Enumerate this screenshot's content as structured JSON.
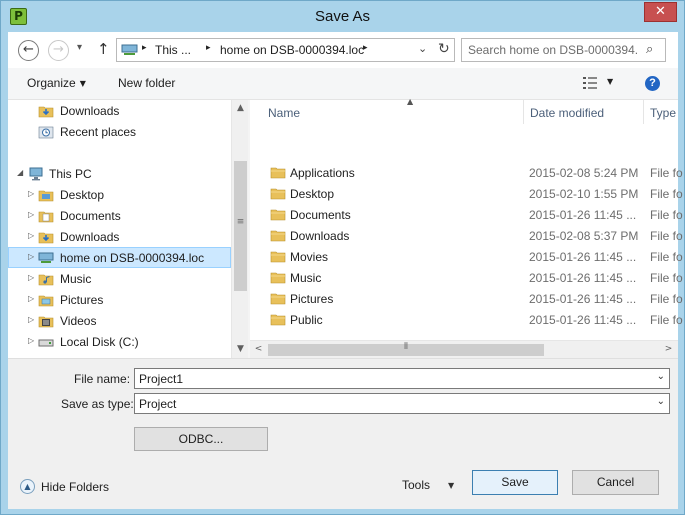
{
  "window": {
    "title": "Save As",
    "app_icon_letter": "P",
    "close_glyph": "✕"
  },
  "address_bar": {
    "back_glyph": "←",
    "forward_glyph": "→",
    "history_glyph": "▾",
    "up_glyph": "↑",
    "crumbs": [
      "This ...",
      "home on DSB-0000394.loc"
    ],
    "separator_glyph": "▸",
    "dropdown_glyph": "⌄",
    "refresh_glyph": "↻",
    "search_placeholder": "Search home on DSB-0000394...",
    "search_glyph": "⌕"
  },
  "toolbar": {
    "organize_label": "Organize",
    "new_folder_label": "New folder",
    "caret_glyph": "▼",
    "help_glyph": "?"
  },
  "nav_pane": {
    "items": [
      {
        "label": "Downloads",
        "icon": "downloads-icon",
        "expander": ""
      },
      {
        "label": "Recent places",
        "icon": "recent-places-icon",
        "expander": ""
      },
      {
        "label": "This PC",
        "icon": "this-pc-icon",
        "expander": "◢"
      },
      {
        "label": "Desktop",
        "icon": "folder-icon",
        "expander": "▷"
      },
      {
        "label": "Documents",
        "icon": "folder-icon",
        "expander": "▷"
      },
      {
        "label": "Downloads",
        "icon": "downloads-icon",
        "expander": "▷"
      },
      {
        "label": "home on DSB-0000394.loc",
        "icon": "network-drive-icon",
        "expander": "▷",
        "selected": true
      },
      {
        "label": "Music",
        "icon": "folder-icon",
        "expander": "▷"
      },
      {
        "label": "Pictures",
        "icon": "folder-icon",
        "expander": "▷"
      },
      {
        "label": "Videos",
        "icon": "folder-icon",
        "expander": "▷"
      },
      {
        "label": "Local Disk (C:)",
        "icon": "local-disk-icon",
        "expander": "▷"
      }
    ],
    "scroll_up_glyph": "▲",
    "scroll_down_glyph": "▼",
    "grip_glyph": "≡"
  },
  "file_list": {
    "columns": [
      "Name",
      "Date modified",
      "Type"
    ],
    "sort_glyph": "▲",
    "rows": [
      {
        "name": "Applications",
        "date": "2015-02-08 5:24 PM",
        "type": "File fo"
      },
      {
        "name": "Desktop",
        "date": "2015-02-10 1:55 PM",
        "type": "File fo"
      },
      {
        "name": "Documents",
        "date": "2015-01-26 11:45 ...",
        "type": "File fo"
      },
      {
        "name": "Downloads",
        "date": "2015-02-08 5:37 PM",
        "type": "File fo"
      },
      {
        "name": "Movies",
        "date": "2015-01-26 11:45 ...",
        "type": "File fo"
      },
      {
        "name": "Music",
        "date": "2015-01-26 11:45 ...",
        "type": "File fo"
      },
      {
        "name": "Pictures",
        "date": "2015-01-26 11:45 ...",
        "type": "File fo"
      },
      {
        "name": "Public",
        "date": "2015-01-26 11:45 ...",
        "type": "File fo"
      }
    ],
    "scroll_left_glyph": "<",
    "scroll_right_glyph": ">",
    "grip_glyph": "⦀"
  },
  "form": {
    "file_name_label": "File name:",
    "file_name_value": "Project1",
    "save_as_type_label": "Save as type:",
    "save_as_type_value": "Project",
    "combo_caret_glyph": "⌄",
    "odbc_label": "ODBC..."
  },
  "footer": {
    "hide_folders_label": "Hide Folders",
    "hide_folders_glyph": "▲",
    "tools_label": "Tools",
    "tools_caret_glyph": "▼",
    "save_label": "Save",
    "cancel_label": "Cancel"
  },
  "colors": {
    "frame": "#a9d3ea",
    "close_button": "#c75050",
    "selection": "#cce8ff",
    "folder": "#e8c05a",
    "help": "#2266c4",
    "default_button_border": "#3c7fb1"
  }
}
